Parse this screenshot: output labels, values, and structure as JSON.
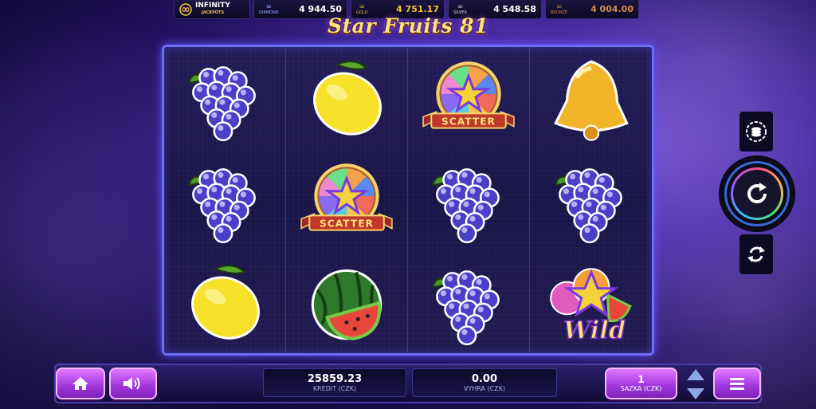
{
  "jackpots": {
    "brand": "INFINITY",
    "brand_sub": "JACKPOTS",
    "tiers": [
      {
        "name": "DIAMOND",
        "value": "4 944.50",
        "color": "#9fb2ff"
      },
      {
        "name": "GOLD",
        "value": "4 751.17",
        "color": "#f5c33b"
      },
      {
        "name": "SILVER",
        "value": "4 548.58",
        "color": "#cfd3dc"
      },
      {
        "name": "BRONZE",
        "value": "4 004.00",
        "color": "#d8894b"
      }
    ]
  },
  "game": {
    "title": "Star Fruits 81"
  },
  "reels": {
    "rows": [
      [
        "grapes",
        "lemon",
        "scatter",
        "bell"
      ],
      [
        "grapes",
        "scatter",
        "grapes",
        "grapes"
      ],
      [
        "lemon",
        "watermelon",
        "grapes",
        "wild"
      ]
    ],
    "scatter_label": "SCATTER",
    "wild_label": "Wild"
  },
  "controls": {
    "credit": {
      "value": "25859.23",
      "label": "KREDIT (CZK)"
    },
    "win": {
      "value": "0.00",
      "label": "VYHRA (CZK)"
    },
    "bet": {
      "value": "1",
      "label": "SAZKA (CZK)"
    },
    "icons": [
      "home-icon",
      "sound-icon",
      "menu-icon",
      "coin-stack-icon",
      "spin-icon",
      "autoplay-icon",
      "bet-up-icon",
      "bet-down-icon"
    ]
  }
}
